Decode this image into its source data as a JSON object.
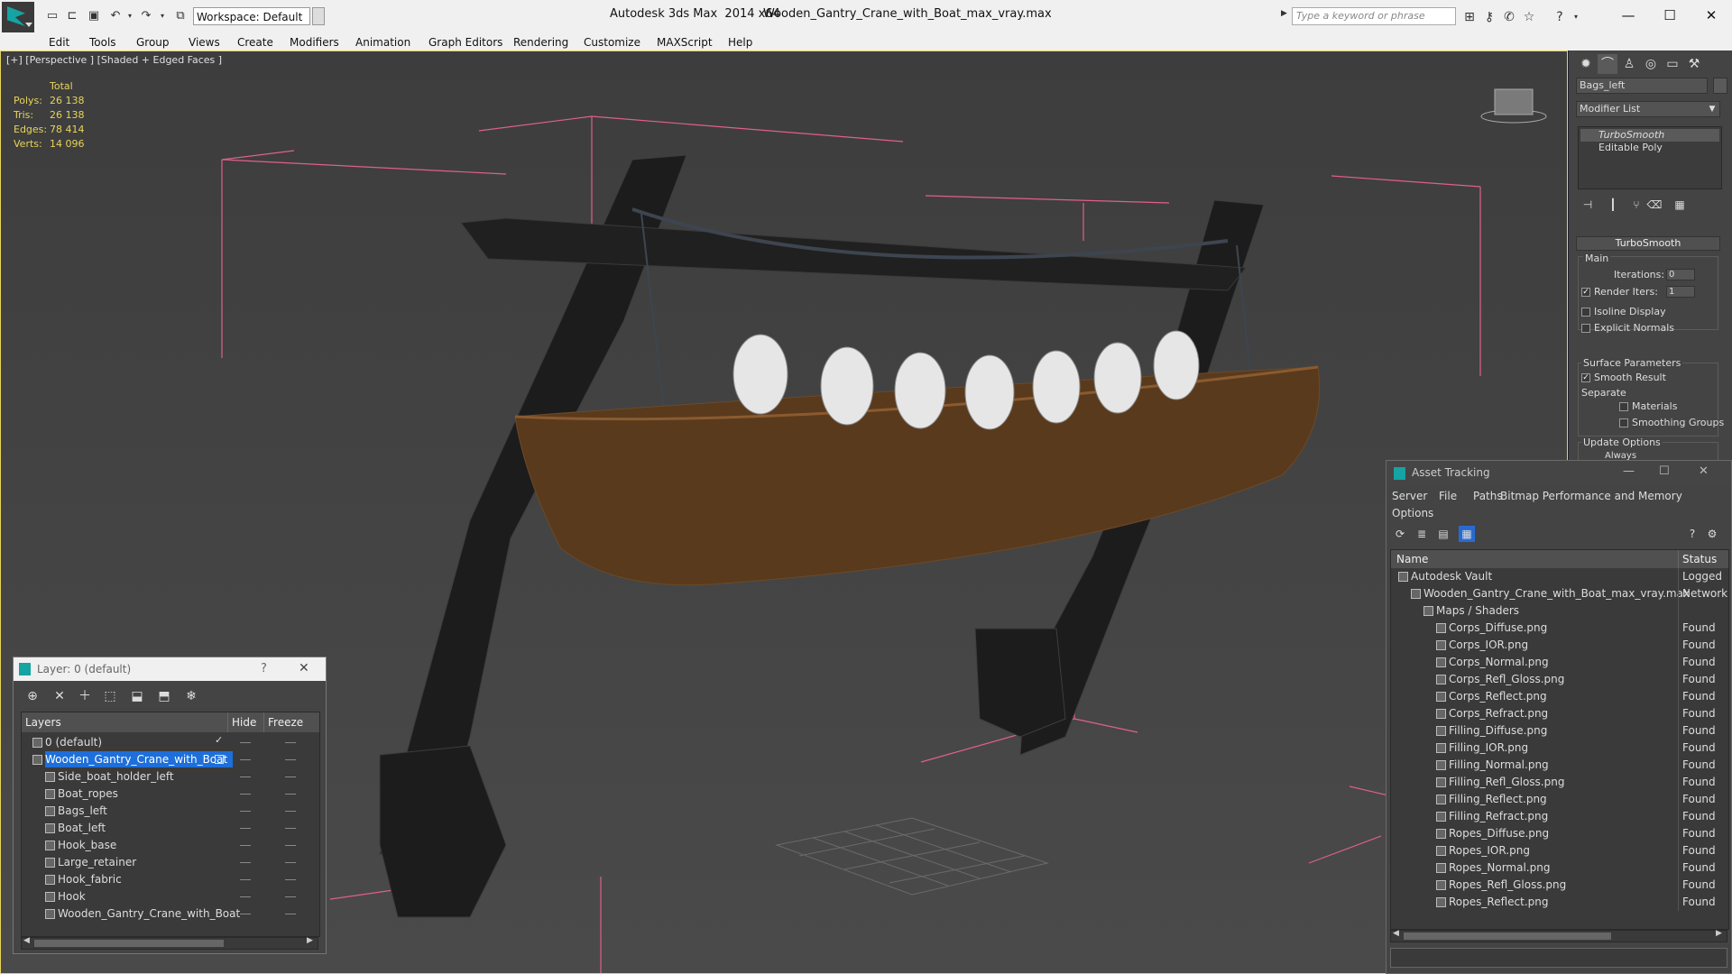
{
  "app": {
    "title": "Autodesk 3ds Max  2014 x64",
    "document": "Wooden_Gantry_Crane_with_Boat_max_vray.max"
  },
  "toolbar": {
    "workspace": "Workspace: Default",
    "search_placeholder": "Type a keyword or phrase"
  },
  "menu": [
    "Edit",
    "Tools",
    "Group",
    "Views",
    "Create",
    "Modifiers",
    "Animation",
    "Graph Editors",
    "Rendering",
    "Customize",
    "MAXScript",
    "Help"
  ],
  "viewport": {
    "label": "[+] [Perspective ] [Shaded + Edged Faces ]",
    "stats": {
      "header": "Total",
      "rows": [
        {
          "label": "Polys:",
          "value": "26 138"
        },
        {
          "label": "Tris:",
          "value": "26 138"
        },
        {
          "label": "Edges:",
          "value": "78 414"
        },
        {
          "label": "Verts:",
          "value": "14 096"
        }
      ]
    }
  },
  "command_panel": {
    "object_name": "Bags_left",
    "modifier_list": "Modifier List",
    "stack": [
      "TurboSmooth",
      "Editable Poly"
    ],
    "rollout": "TurboSmooth",
    "main_group": "Main",
    "iterations_label": "Iterations:",
    "iterations_value": "0",
    "render_iters_label": "Render Iters:",
    "render_iters_value": "1",
    "isoline": "Isoline Display",
    "explicit_normals": "Explicit Normals",
    "surface_group": "Surface Parameters",
    "smooth_result": "Smooth Result",
    "separate": "Separate",
    "materials": "Materials",
    "smoothing_groups": "Smoothing Groups",
    "update_group": "Update Options",
    "always": "Always"
  },
  "asset_tracking": {
    "title": "Asset Tracking",
    "menu": [
      "Server",
      "File",
      "Paths",
      "Bitmap Performance and Memory"
    ],
    "menu2": "Options",
    "columns": {
      "name": "Name",
      "status": "Status"
    },
    "rows": [
      {
        "name": "Autodesk Vault",
        "status": "Logged",
        "indent": 0
      },
      {
        "name": "Wooden_Gantry_Crane_with_Boat_max_vray.max",
        "status": "Network",
        "indent": 1
      },
      {
        "name": "Maps / Shaders",
        "status": "",
        "indent": 2
      },
      {
        "name": "Corps_Diffuse.png",
        "status": "Found",
        "indent": 3
      },
      {
        "name": "Corps_IOR.png",
        "status": "Found",
        "indent": 3
      },
      {
        "name": "Corps_Normal.png",
        "status": "Found",
        "indent": 3
      },
      {
        "name": "Corps_Refl_Gloss.png",
        "status": "Found",
        "indent": 3
      },
      {
        "name": "Corps_Reflect.png",
        "status": "Found",
        "indent": 3
      },
      {
        "name": "Corps_Refract.png",
        "status": "Found",
        "indent": 3
      },
      {
        "name": "Filling_Diffuse.png",
        "status": "Found",
        "indent": 3
      },
      {
        "name": "Filling_IOR.png",
        "status": "Found",
        "indent": 3
      },
      {
        "name": "Filling_Normal.png",
        "status": "Found",
        "indent": 3
      },
      {
        "name": "Filling_Refl_Gloss.png",
        "status": "Found",
        "indent": 3
      },
      {
        "name": "Filling_Reflect.png",
        "status": "Found",
        "indent": 3
      },
      {
        "name": "Filling_Refract.png",
        "status": "Found",
        "indent": 3
      },
      {
        "name": "Ropes_Diffuse.png",
        "status": "Found",
        "indent": 3
      },
      {
        "name": "Ropes_IOR.png",
        "status": "Found",
        "indent": 3
      },
      {
        "name": "Ropes_Normal.png",
        "status": "Found",
        "indent": 3
      },
      {
        "name": "Ropes_Refl_Gloss.png",
        "status": "Found",
        "indent": 3
      },
      {
        "name": "Ropes_Reflect.png",
        "status": "Found",
        "indent": 3
      }
    ]
  },
  "layer_dialog": {
    "title": "Layer: 0 (default)",
    "help": "?",
    "columns": {
      "layers": "Layers",
      "hide": "Hide",
      "freeze": "Freeze"
    },
    "rows": [
      {
        "name": "0 (default)",
        "indent": 0,
        "selected": false
      },
      {
        "name": "Wooden_Gantry_Crane_with_Boat",
        "indent": 0,
        "selected": true
      },
      {
        "name": "Side_boat_holder_left",
        "indent": 1,
        "selected": false
      },
      {
        "name": "Boat_ropes",
        "indent": 1,
        "selected": false
      },
      {
        "name": "Bags_left",
        "indent": 1,
        "selected": false
      },
      {
        "name": "Boat_left",
        "indent": 1,
        "selected": false
      },
      {
        "name": "Hook_base",
        "indent": 1,
        "selected": false
      },
      {
        "name": "Large_retainer",
        "indent": 1,
        "selected": false
      },
      {
        "name": "Hook_fabric",
        "indent": 1,
        "selected": false
      },
      {
        "name": "Hook",
        "indent": 1,
        "selected": false
      },
      {
        "name": "Wooden_Gantry_Crane_with_Boat",
        "indent": 1,
        "selected": false
      }
    ]
  },
  "colors": {
    "accent": "#1e6fd9",
    "viewport_border": "#e8d45a",
    "stats": "#e8d45a",
    "brand": "#15a3a3"
  }
}
